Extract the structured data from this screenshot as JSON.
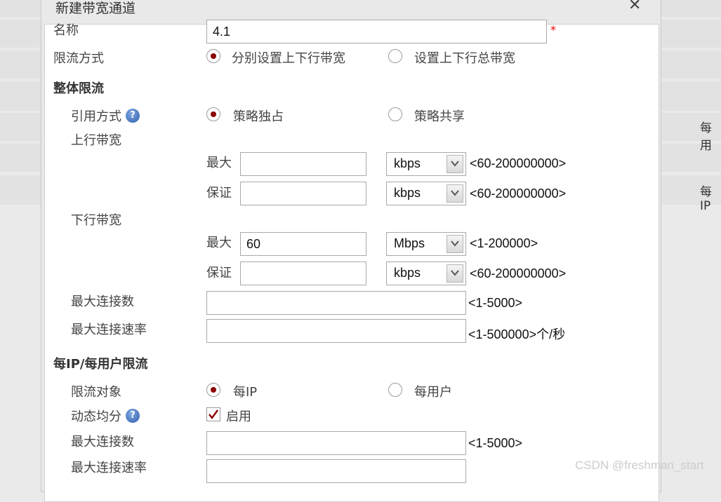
{
  "background": {
    "right_labels": [
      "每用",
      "每IP"
    ]
  },
  "dialog": {
    "title": "新建带宽通道",
    "close_symbol": "✕"
  },
  "form": {
    "name": {
      "label": "名称",
      "value": "4.1",
      "required_mark": "*"
    },
    "limit_mode": {
      "label": "限流方式",
      "options": [
        "分别设置上下行带宽",
        "设置上下行总带宽"
      ],
      "selected": 0
    },
    "overall": {
      "section_title": "整体限流",
      "ref_mode": {
        "label": "引用方式",
        "options": [
          "策略独占",
          "策略共享"
        ],
        "selected": 0
      },
      "upstream": {
        "label": "上行带宽",
        "max": {
          "label": "最大",
          "value": "",
          "unit": "kbps",
          "range": "<60-200000000>"
        },
        "guarantee": {
          "label": "保证",
          "value": "",
          "unit": "kbps",
          "range": "<60-200000000>"
        }
      },
      "downstream": {
        "label": "下行带宽",
        "max": {
          "label": "最大",
          "value": "60",
          "unit": "Mbps",
          "range": "<1-200000>"
        },
        "guarantee": {
          "label": "保证",
          "value": "",
          "unit": "kbps",
          "range": "<60-200000000>"
        }
      },
      "max_conn": {
        "label": "最大连接数",
        "value": "",
        "range": "<1-5000>"
      },
      "max_conn_rate": {
        "label": "最大连接速率",
        "value": "",
        "range": "<1-500000>个/秒"
      }
    },
    "per_ip": {
      "section_title": "每IP/每用户限流",
      "target": {
        "label": "限流对象",
        "options": [
          "每IP",
          "每用户"
        ],
        "selected": 0
      },
      "dynamic": {
        "label": "动态均分",
        "checkbox_label": "启用",
        "checked": true
      },
      "max_conn": {
        "label": "最大连接数",
        "value": "",
        "range": "<1-5000>"
      },
      "max_conn_rate": {
        "label": "最大连接速率"
      }
    }
  },
  "help_symbol": "?",
  "watermark": "CSDN @freshman_start",
  "colors": {
    "radio_dot": "#8b0000",
    "required": "#ee0000",
    "help_icon": "#2f5fb0"
  }
}
